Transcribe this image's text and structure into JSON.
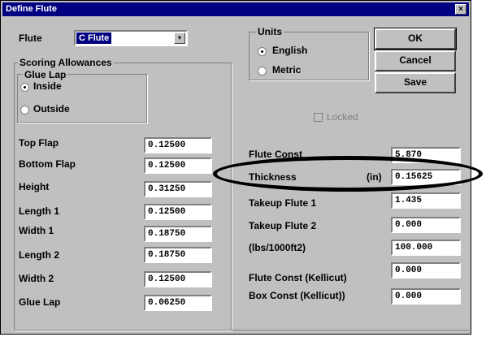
{
  "window": {
    "title": "Define Flute",
    "close_glyph": "×"
  },
  "flute": {
    "label": "Flute",
    "selected": "C Flute",
    "dropdown_icon": "▾"
  },
  "units": {
    "legend": "Units",
    "options": [
      {
        "label": "English",
        "selected": true
      },
      {
        "label": "Metric",
        "selected": false
      }
    ]
  },
  "buttons": {
    "ok": "OK",
    "cancel": "Cancel",
    "save": "Save"
  },
  "locked": {
    "label": "Locked",
    "checked": false
  },
  "scoring": {
    "legend": "Scoring Allowances"
  },
  "glue_lap_group": {
    "legend": "Glue Lap",
    "options": [
      {
        "label": "Inside",
        "selected": true
      },
      {
        "label": "Outside",
        "selected": false
      }
    ]
  },
  "left_fields": [
    {
      "label": "Top Flap",
      "value": "0.12500"
    },
    {
      "label": "Bottom Flap",
      "value": "0.12500"
    },
    {
      "label": "Height",
      "value": "0.31250"
    },
    {
      "label": "Length 1",
      "value": "0.12500"
    },
    {
      "label": "Width 1",
      "value": "0.18750"
    },
    {
      "label": "Length 2",
      "value": "0.18750"
    },
    {
      "label": "Width 2",
      "value": "0.12500"
    },
    {
      "label": "Glue Lap",
      "value": "0.06250"
    }
  ],
  "right_fields": [
    {
      "label": "Flute Const",
      "value": "5.870"
    },
    {
      "label": "Thickness",
      "unit": "(in)",
      "value": "0.15625"
    },
    {
      "label": "Takeup Flute 1",
      "value": "1.435"
    },
    {
      "label": "Takeup Flute 2",
      "value": "0.000"
    },
    {
      "label": "(lbs/1000ft2)",
      "value": "100.000"
    },
    {
      "label": "Flute Const (Kellicut)",
      "value": "0.000"
    },
    {
      "label": "Box Const (Kellicut))",
      "value": "0.000"
    }
  ],
  "colors": {
    "dialog_bg": "#c0c0c0",
    "titlebar": "#000080",
    "highlight_ring": "#000000"
  }
}
